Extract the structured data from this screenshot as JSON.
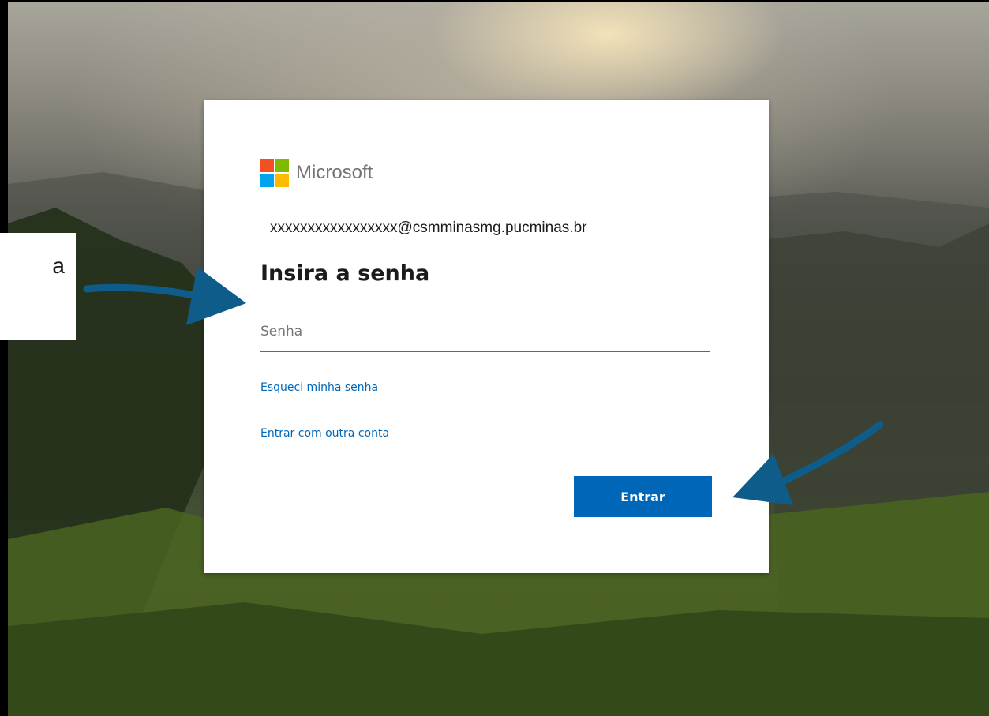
{
  "callout": {
    "text": "a"
  },
  "logo": {
    "text": "Microsoft"
  },
  "login": {
    "account": "xxxxxxxxxxxxxxxxx@csmminasmg.pucminas.br",
    "heading": "Insira a senha",
    "password_placeholder": "Senha",
    "forgot_link": "Esqueci minha senha",
    "other_account_link": "Entrar com outra conta",
    "submit_label": "Entrar"
  },
  "colors": {
    "accent": "#0067b8",
    "logo_red": "#f25022",
    "logo_green": "#7fba00",
    "logo_blue": "#00a4ef",
    "logo_yellow": "#ffb900",
    "arrow": "#0e5c8a"
  }
}
